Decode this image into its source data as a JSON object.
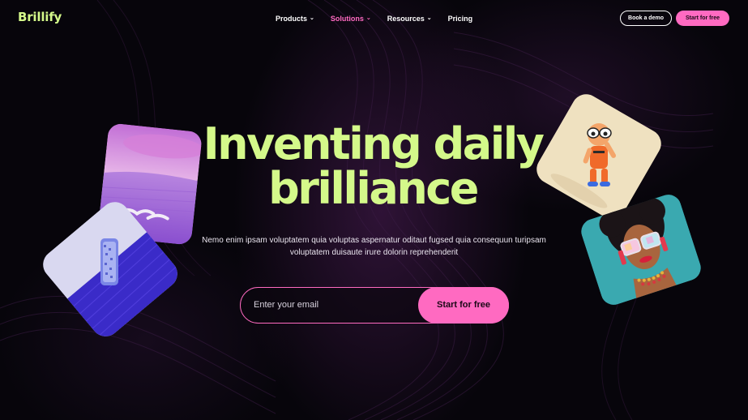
{
  "brand": {
    "name": "Brillify",
    "accent": "#d4f98a",
    "pink": "#ff6ac1"
  },
  "nav": {
    "items": [
      {
        "label": "Products",
        "has_dropdown": true,
        "active": false
      },
      {
        "label": "Solutions",
        "has_dropdown": true,
        "active": true
      },
      {
        "label": "Resources",
        "has_dropdown": true,
        "active": false
      },
      {
        "label": "Pricing",
        "has_dropdown": false,
        "active": false
      }
    ],
    "book_demo_label": "Book a demo",
    "start_label": "Start for free"
  },
  "hero": {
    "headline_line1": "Inventing daily",
    "headline_line2": "brilliance",
    "subtitle": "Nemo enim ipsam voluptatem quia voluptas aspernatur oditaut fugsed quia consequun turipsam voluptatem duisaute irure dolorin reprehenderit",
    "email_placeholder": "Enter your email",
    "cta_label": "Start for free"
  },
  "icons": {
    "dropdown": "chevron-down-icon"
  }
}
